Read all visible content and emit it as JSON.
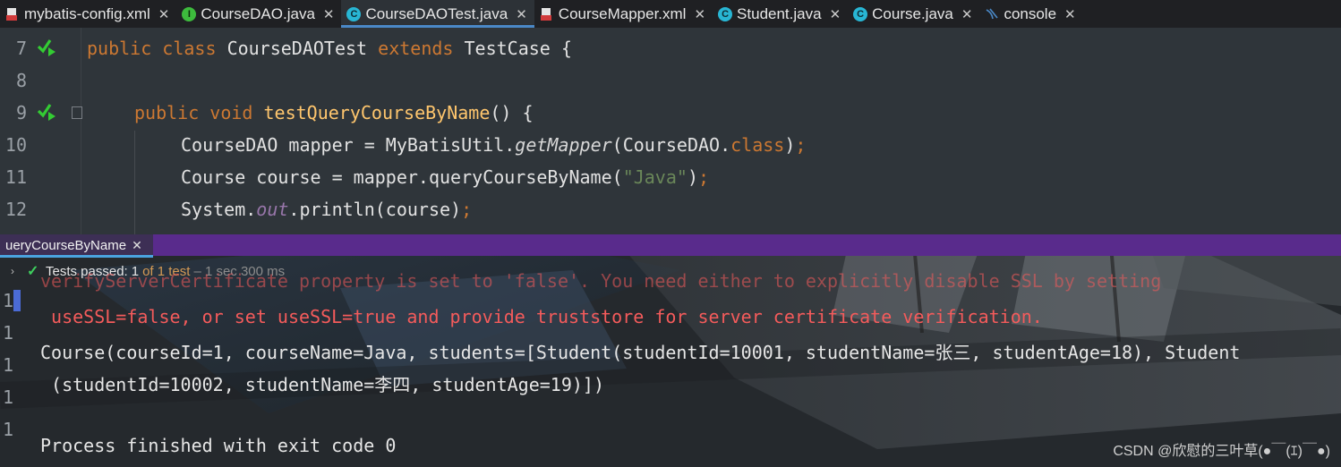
{
  "tabs": [
    {
      "label": "mybatis-config.xml",
      "icon": "xml-file-icon",
      "active": false
    },
    {
      "label": "CourseDAO.java",
      "icon": "interface-icon",
      "active": false
    },
    {
      "label": "CourseDAOTest.java",
      "icon": "class-icon",
      "active": true
    },
    {
      "label": "CourseMapper.xml",
      "icon": "xml-file-icon",
      "active": false
    },
    {
      "label": "Student.java",
      "icon": "class-icon",
      "active": false
    },
    {
      "label": "Course.java",
      "icon": "class-icon",
      "active": false
    },
    {
      "label": "console",
      "icon": "console-icon",
      "active": false
    }
  ],
  "editor": {
    "line_numbers": [
      "7",
      "8",
      "9",
      "10",
      "11",
      "12"
    ],
    "line7": {
      "kw1": "public",
      "kw2": "class",
      "name": "CourseDAOTest",
      "kw3": "extends",
      "base": "TestCase",
      "brace": "{"
    },
    "line9": {
      "kw1": "public",
      "kw2": "void",
      "method": "testQueryCourseByName",
      "rest": "() {"
    },
    "line10": {
      "a": "CourseDAO mapper = MyBatisUtil.",
      "b": "getMapper",
      "c": "(CourseDAO.",
      "d": "class",
      "e": ")",
      "f": ";"
    },
    "line11": {
      "a": "Course course = mapper.queryCourseByName(",
      "b": "\"Java\"",
      "c": ")",
      "d": ";"
    },
    "line12": {
      "a": "System.",
      "b": "out",
      "c": ".println(course)",
      "d": ";"
    }
  },
  "run_panel": {
    "tab_label": "ueryCourseByName",
    "status": {
      "prefix": "Tests passed:",
      "count": "1",
      "of": "of 1 test",
      "time": "– 1 sec 300 ms"
    },
    "gutter_numbers": [
      "1",
      "1",
      "1",
      "1",
      "1"
    ],
    "console_lines": {
      "err1": "verifyServerCertificate property is set to 'false'. You need either to explicitly disable SSL by setting",
      "err2": " useSSL=false, or set useSSL=true and provide truststore for server certificate verification.",
      "out1": "Course(courseId=1, courseName=Java, students=[Student(studentId=10001, studentName=张三, studentAge=18), Student",
      "out2": " (studentId=10002, studentName=李四, studentAge=19)])",
      "out3": "Process finished with exit code 0"
    }
  },
  "watermark": "CSDN @欣慰的三叶草(●￣(ｴ)￣●)",
  "colors": {
    "keyword": "#cc7832",
    "method": "#ffc66d",
    "string": "#6a8759",
    "field": "#9876aa",
    "error": "#f45b5b",
    "pass": "#3ecf5e"
  }
}
